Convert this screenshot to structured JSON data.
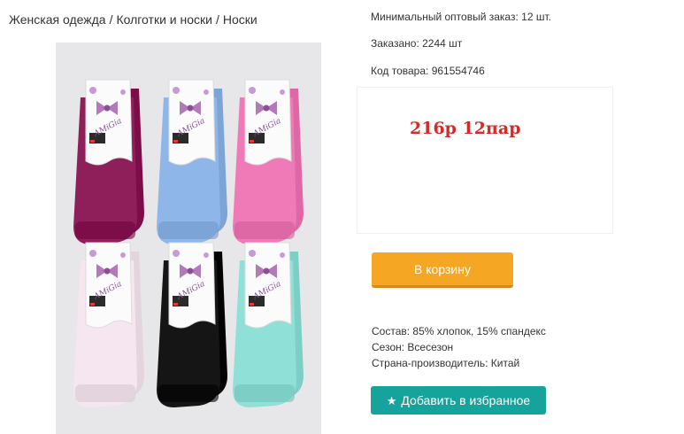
{
  "breadcrumb": {
    "items": [
      "Женская одежда",
      "Колготки и носки",
      "Носки"
    ],
    "separator": "/"
  },
  "product": {
    "min_order": "Минимальный оптовый заказ: 12 шт.",
    "ordered": "Заказано: 2244 шт",
    "code": "Код товара: 961554746",
    "price_note": "216р 12пар"
  },
  "cart_button": {
    "label": "В корзину",
    "color": "#f5a623"
  },
  "specs": {
    "composition": "Состав: 85% хлопок, 15% спандекс",
    "season": "Сезон: Всесезон",
    "country": "Страна-производитель: Китай"
  },
  "favorite_button": {
    "label": "Добавить в избранное",
    "icon": "star-icon",
    "color": "#15a39b"
  },
  "photo": {
    "brand_label": "AMiGia",
    "sock_colors": [
      "#8e1f5a",
      "#8fb6e8",
      "#f07ab8",
      "#f6e6ef",
      "#151515",
      "#8fe0d6"
    ]
  },
  "colors": {
    "price": "#d62a2a"
  }
}
